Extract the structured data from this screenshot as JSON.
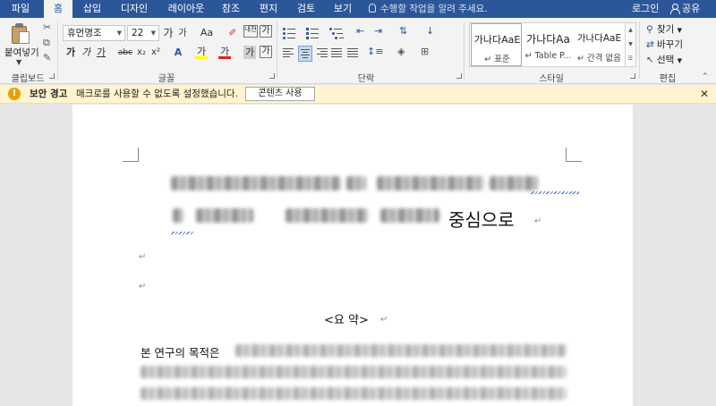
{
  "tabs": [
    "파일",
    "홈",
    "삽입",
    "디자인",
    "레이아웃",
    "참조",
    "편지",
    "검토",
    "보기"
  ],
  "tell_me": "수행할 작업을 알려 주세요.",
  "login": "로그인",
  "share": "공유",
  "clipboard": {
    "paste": "붙여넣기",
    "group": "클립보드"
  },
  "font": {
    "name": "휴먼명조",
    "size": "22",
    "grow": "가",
    "shrink": "가",
    "case": "Aa",
    "bold": "가",
    "italic": "가",
    "underline": "가",
    "strike": "abc",
    "subscript": "x₂",
    "superscript": "x²",
    "phonetic": "내천",
    "enclose": "가",
    "highlight": "가",
    "fontcolor": "가",
    "shading": "가",
    "border": "가",
    "group": "글꼴"
  },
  "paragraph": {
    "group": "단락"
  },
  "styles": {
    "group": "스타일",
    "items": [
      {
        "sample": "가나다AaE",
        "name": "↵ 표준"
      },
      {
        "sample": "가나다Aa",
        "name": "↵ Table P..."
      },
      {
        "sample": "가나다AaE",
        "name": "↵ 간격 없음"
      }
    ]
  },
  "editing": {
    "group": "편집",
    "find": "찾기",
    "replace": "바꾸기",
    "select": "선택"
  },
  "security": {
    "title": "보안 경고",
    "message": "매크로를 사용할 수 없도록 설정했습니다.",
    "button": "콘텐츠 사용",
    "close": "✕"
  },
  "document": {
    "title_tail": "중심으로",
    "para_mark": "↵",
    "summary_heading": "<요 약>",
    "body_start": "본 연구의 목적은"
  }
}
